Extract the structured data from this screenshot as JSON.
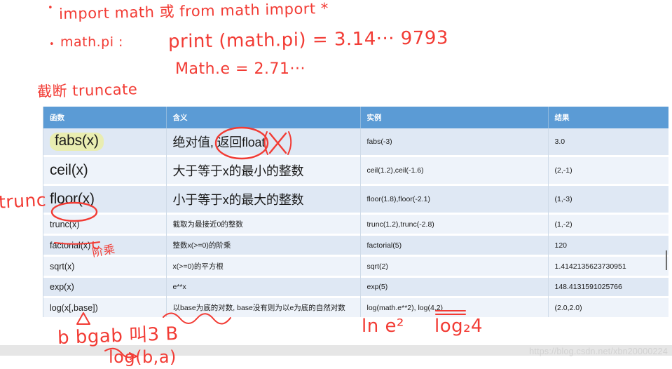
{
  "notes": {
    "line1_bullet": "•",
    "line1": "import math 或 from math import *",
    "line2_bullet": "•",
    "line2_label": "math.pi :",
    "line2_expr": "print (math.pi) = 3.14··· 9793",
    "line3_expr": "Math.e = 2.71···",
    "line4": "截断 truncate",
    "left_margin_trunc": "trunc",
    "factorial_note": "阶乘",
    "log_note_1": "ln e²",
    "log_note_2": "log₂4",
    "log_note_3": "b bgab 叫3 B",
    "log_note_4": "log(b,a)",
    "cross_mark": "X"
  },
  "table": {
    "headers": [
      "函数",
      "含义",
      "实例",
      "结果"
    ],
    "rows": [
      {
        "func": "fabs(x)",
        "meaning": "绝对值, 返回float",
        "example": "fabs(-3)",
        "result": "3.0",
        "size": "big",
        "highlight": true
      },
      {
        "func": "ceil(x)",
        "meaning": "大于等于x的最小的整数",
        "example": "ceil(1.2),ceil(-1.6)",
        "result": "(2,-1)",
        "size": "big",
        "highlight": false
      },
      {
        "func": "floor(x)",
        "meaning": "小于等于x的最大的整数",
        "example": "floor(1.8),floor(-2.1)",
        "result": "(1,-3)",
        "size": "big",
        "highlight": false
      },
      {
        "func": "trunc(x)",
        "meaning": "截取为最接近0的整数",
        "example": "trunc(1.2),trunc(-2.8)",
        "result": "(1,-2)",
        "size": "small",
        "highlight": false
      },
      {
        "func": "factorial(x)",
        "meaning": "整数x(>=0)的阶乘",
        "example": "factorial(5)",
        "result": "120",
        "size": "small",
        "highlight": false
      },
      {
        "func": "sqrt(x)",
        "meaning": "x(>=0)的平方根",
        "example": "sqrt(2)",
        "result": "1.4142135623730951",
        "size": "small",
        "highlight": false
      },
      {
        "func": "exp(x)",
        "meaning": "e**x",
        "example": "exp(5)",
        "result": "148.4131591025766",
        "size": "small",
        "highlight": false
      },
      {
        "func": "log(x[,base])",
        "meaning": "以base为底的对数, base没有则为以e为底的自然对数",
        "example": "log(math.e**2), log(4,2)",
        "result": "(2.0,2.0)",
        "size": "small",
        "highlight": false
      }
    ]
  },
  "watermark": "https://blog.csdn.net/xbn20000224",
  "colors": {
    "header_blue": "#5b9bd5",
    "band_a": "#dfe8f4",
    "band_b": "#eef3fa",
    "ink_red": "#f23b34",
    "highlight_yellow": "#e9edb1"
  }
}
